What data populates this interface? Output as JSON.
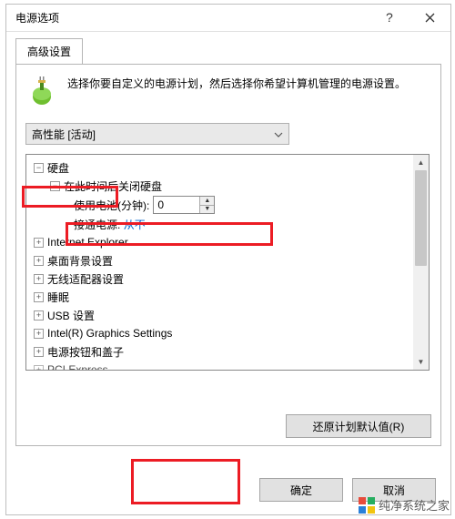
{
  "window": {
    "title": "电源选项"
  },
  "tab": {
    "label": "高级设置"
  },
  "description": "选择你要自定义的电源计划，然后选择你希望计算机管理的电源设置。",
  "plan_combo": {
    "selected": "高性能 [活动]"
  },
  "tree": {
    "hdd": {
      "label": "硬盘"
    },
    "hdd_off": {
      "label": "在此时间后关闭硬盘"
    },
    "on_battery_label": "使用电池(分钟):",
    "on_battery_value": "0",
    "plugged_label": "接通电源:",
    "plugged_value": "从不",
    "ie": {
      "label": "Internet Explorer"
    },
    "desktop_bg": {
      "label": "桌面背景设置"
    },
    "wireless": {
      "label": "无线适配器设置"
    },
    "sleep": {
      "label": "睡眠"
    },
    "usb": {
      "label": "USB 设置"
    },
    "intel_gfx": {
      "label": "Intel(R) Graphics Settings"
    },
    "power_button": {
      "label": "电源按钮和盖子"
    },
    "pci": {
      "label": "PCI Express"
    }
  },
  "buttons": {
    "restore": "还原计划默认值(R)",
    "ok": "确定",
    "cancel": "取消"
  },
  "watermark": "纯净系统之家"
}
